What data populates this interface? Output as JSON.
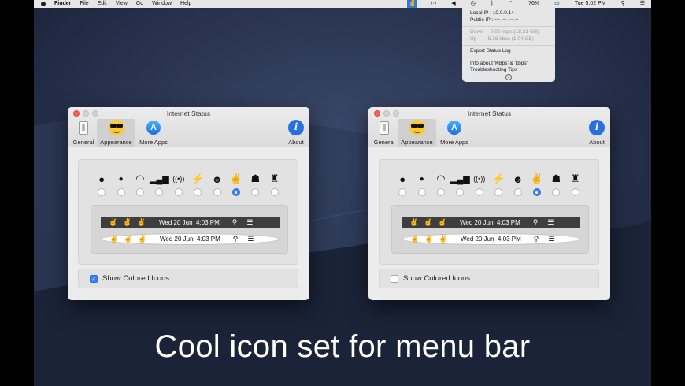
{
  "menubar": {
    "app": "Finder",
    "menus": [
      "File",
      "Edit",
      "View",
      "Go",
      "Window",
      "Help"
    ],
    "battery": "76%",
    "clock": "Tue 5:02 PM"
  },
  "dropdown": {
    "local_ip_label": "Local IP",
    "local_ip": "10.0.0.14",
    "public_ip_label": "Public IP :",
    "public_ip": "•••.•••.•••.••",
    "down_label": "Down",
    "down_value": "0.00 kbps (18.31 GB)",
    "up_label": "Up",
    "up_value": "5.16 kbps (1.04 GB)",
    "export": "Export Status Log",
    "info": "Info about 'KBps' & 'kbps'",
    "tips": "Troubleshooting Tips"
  },
  "windows": [
    {
      "title": "Internet Status",
      "toolbar": {
        "general": "General",
        "appearance": "Appearance",
        "more": "More Apps",
        "about": "About"
      },
      "bar_date": "Wed 20 Jun",
      "bar_time": "4:03 PM",
      "checkbox_label": "Show Colored Icons",
      "checked": true
    },
    {
      "title": "Internet Status",
      "toolbar": {
        "general": "General",
        "appearance": "Appearance",
        "more": "More Apps",
        "about": "About"
      },
      "bar_date": "Wed 20 Jun",
      "bar_time": "4:03 PM",
      "checkbox_label": "Show Colored Icons",
      "checked": false
    }
  ],
  "icon_set": [
    "ellipsis-face",
    "dot",
    "wifi",
    "signal-bars",
    "broadcast",
    "plug",
    "smiley",
    "rock-hand",
    "stormtrooper",
    "ironman"
  ],
  "selected_icon_index": 7,
  "caption": "Cool icon set for menu bar"
}
